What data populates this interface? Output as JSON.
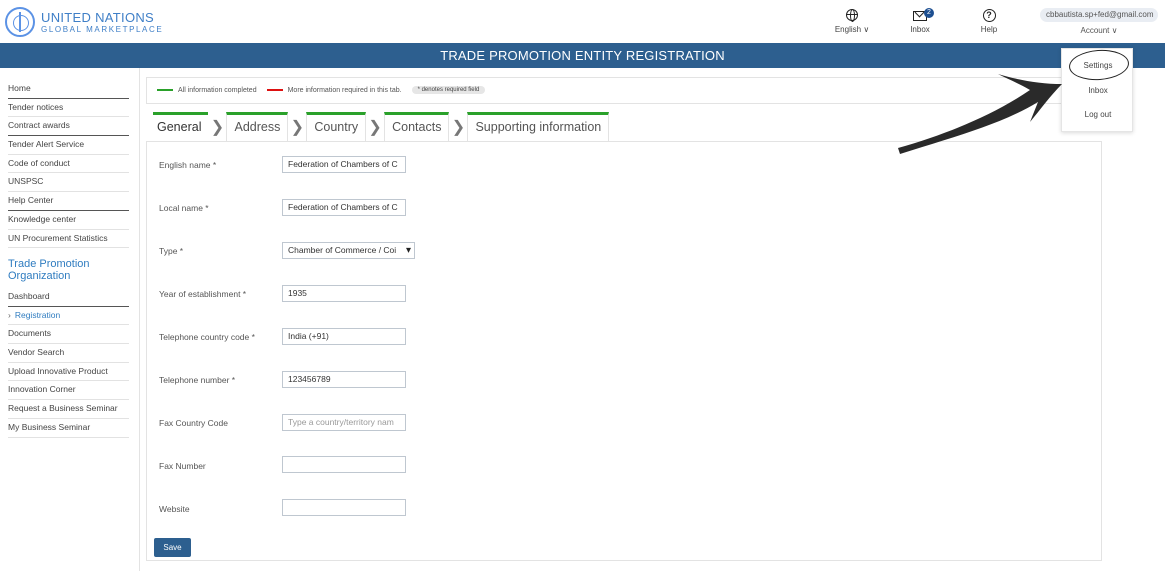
{
  "header": {
    "logo_title": "UNITED NATIONS",
    "logo_sub": "GLOBAL MARKETPLACE",
    "language": "English",
    "inbox_label": "Inbox",
    "inbox_count": "2",
    "help_label": "Help",
    "email": "cbbautista.sp+fed@gmail.com",
    "account_label": "Account"
  },
  "banner_title": "TRADE PROMOTION ENTITY REGISTRATION",
  "sidebar": {
    "items": [
      "Home",
      "Tender notices",
      "Contract awards",
      "Tender Alert Service",
      "Code of conduct",
      "UNSPSC",
      "Help Center",
      "Knowledge center",
      "UN Procurement Statistics"
    ],
    "section_title": "Trade Promotion Organization",
    "section_items": [
      "Dashboard",
      "Registration",
      "Documents",
      "Vendor Search",
      "Upload Innovative Product",
      "Innovation Corner",
      "Request a Business Seminar",
      "My Business Seminar"
    ]
  },
  "legend": {
    "completed": "All information completed",
    "more_required": "More information required in this tab.",
    "required_note": "* denotes required field"
  },
  "tabs": [
    "General",
    "Address",
    "Country",
    "Contacts",
    "Supporting information"
  ],
  "form": {
    "english_name_label": "English name *",
    "english_name_value": "Federation of Chambers of C",
    "local_name_label": "Local name *",
    "local_name_value": "Federation of Chambers of C",
    "type_label": "Type *",
    "type_value": "Chamber of Commerce / Coi",
    "year_label": "Year of establishment *",
    "year_value": "1935",
    "tel_code_label": "Telephone country code *",
    "tel_code_value": "India (+91)",
    "tel_number_label": "Telephone number *",
    "tel_number_value": "123456789",
    "fax_code_label": "Fax Country Code",
    "fax_code_placeholder": "Type a country/territory nam",
    "fax_number_label": "Fax Number",
    "website_label": "Website",
    "save_label": "Save"
  },
  "account_menu": {
    "settings": "Settings",
    "inbox": "Inbox",
    "logout": "Log out"
  },
  "colors": {
    "banner": "#2d5f8f",
    "complete_green": "#2aa12a",
    "required_red": "#dd1111",
    "link_blue": "#2f7cc0"
  }
}
